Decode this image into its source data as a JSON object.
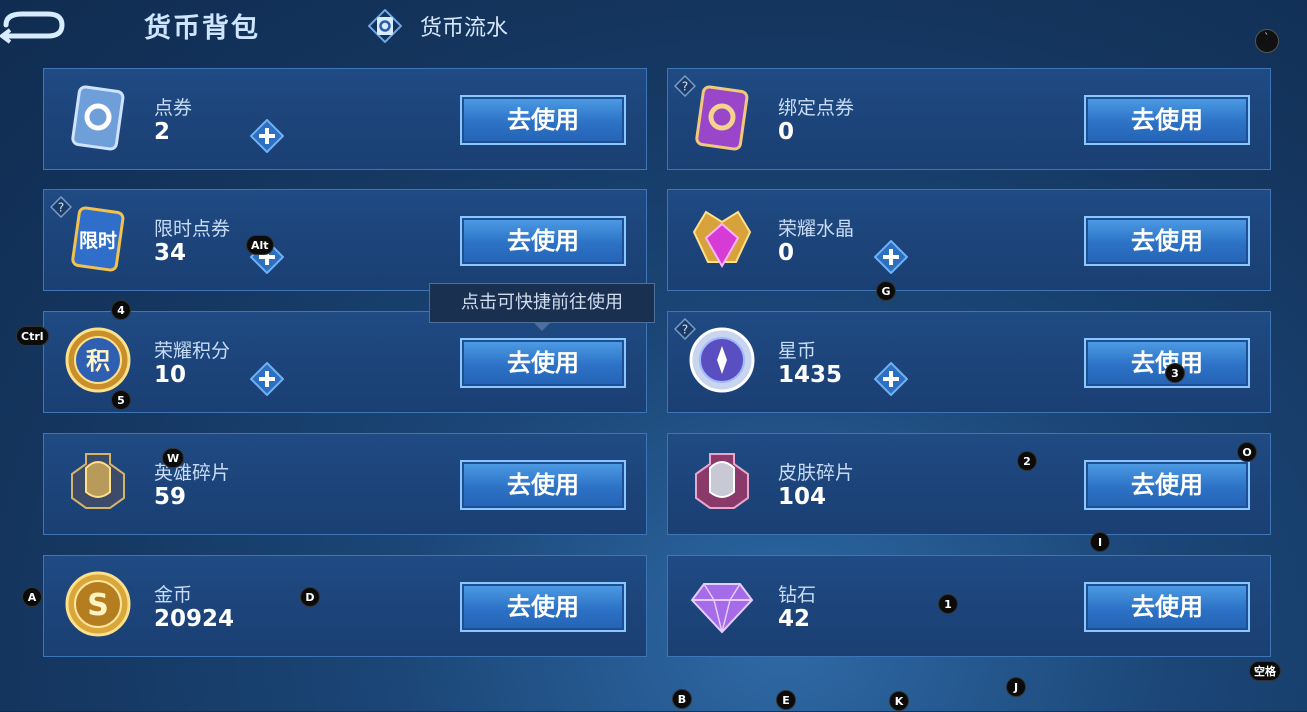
{
  "header": {
    "title": "货币背包",
    "flow_tab": "货币流水"
  },
  "tooltip": "点击可快捷前往使用",
  "use_label": "去使用",
  "currencies": [
    {
      "name": "点券",
      "value": "2"
    },
    {
      "name": "绑定点券",
      "value": "0"
    },
    {
      "name": "限时点券",
      "value": "34",
      "badge": "限时"
    },
    {
      "name": "荣耀水晶",
      "value": "0"
    },
    {
      "name": "荣耀积分",
      "value": "10",
      "badge": "积"
    },
    {
      "name": "星币",
      "value": "1435"
    },
    {
      "name": "英雄碎片",
      "value": "59"
    },
    {
      "name": "皮肤碎片",
      "value": "104"
    },
    {
      "name": "金币",
      "value": "20924",
      "badge": "S"
    },
    {
      "name": "钻石",
      "value": "42"
    }
  ],
  "hotkeys": {
    "corner": "`",
    "alt": "Alt",
    "four": "4",
    "ctrl": "Ctrl",
    "five": "5",
    "g": "G",
    "three": "3",
    "w": "W",
    "two": "2",
    "o": "O",
    "i": "I",
    "a": "A",
    "d": "D",
    "one": "1",
    "space": "空格",
    "b": "B",
    "e": "E",
    "k": "K",
    "j": "J"
  }
}
